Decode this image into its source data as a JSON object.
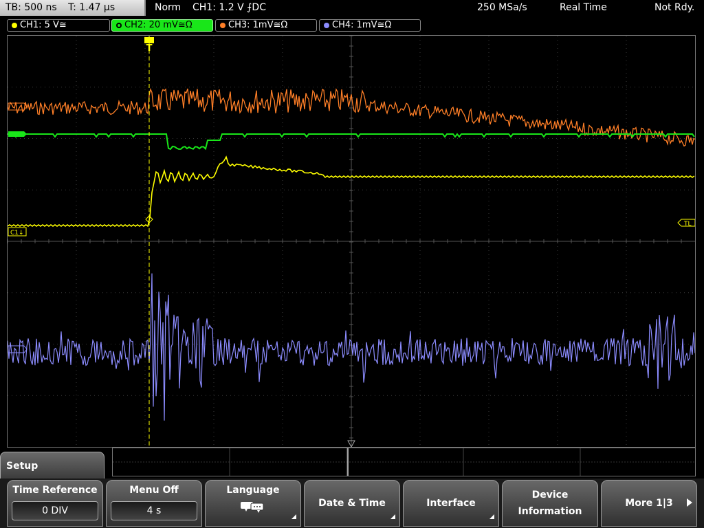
{
  "status": {
    "timebase": "TB: 500 ns",
    "trigger_time": "T: 1.47 µs",
    "mode": "Norm",
    "trigger_source": "CH1: 1.2 V ⨍DC",
    "sample_rate": "250 MSa/s",
    "acq_mode": "Real Time",
    "state": "Not Rdy."
  },
  "channels": [
    {
      "label": "CH1: 5 V≅",
      "color": "#ffff00",
      "active": false
    },
    {
      "label": "CH2: 20 mV≅Ω",
      "color": "#19e619",
      "active": true
    },
    {
      "label": "CH3: 1mV≅Ω",
      "color": "#ff7f27",
      "active": false
    },
    {
      "label": "CH4: 1mV≅Ω",
      "color": "#8c8cff",
      "active": false
    }
  ],
  "screen_markers": {
    "trigger_marker": "T",
    "ch1_marker": "C1↓",
    "trigger_level_marker": "TL"
  },
  "menu": {
    "title": "Setup",
    "softkeys": [
      {
        "label": "Time Reference",
        "value": "0 DIV"
      },
      {
        "label": "Menu Off",
        "value": "4 s"
      },
      {
        "label": "Language",
        "icon": "speech-bubbles-icon"
      },
      {
        "label": "Date & Time"
      },
      {
        "label": "Interface"
      },
      {
        "label": "Device Information"
      },
      {
        "label": "More 1|3",
        "icon": "right-arrow-icon"
      }
    ]
  }
}
